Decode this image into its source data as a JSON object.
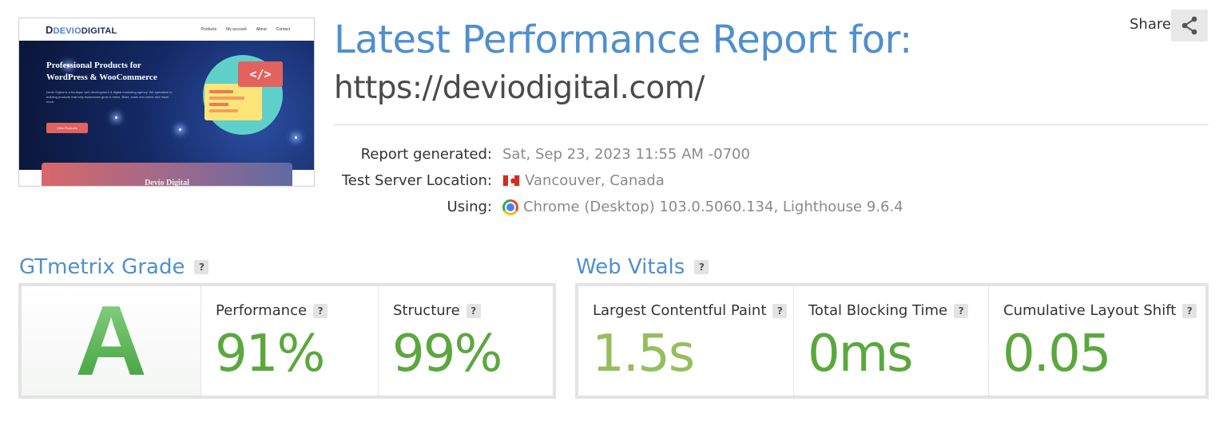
{
  "thumbnail": {
    "logo_letter": "D",
    "logo_text_a": "DEVIO",
    "logo_text_b": "DIGITAL",
    "nav": [
      "Products",
      "My account",
      "About",
      "Contact"
    ],
    "hero_title": "Professional Products for WordPress & WooCommerce",
    "hero_body": "Devio Digital is a boutique web development & digital marketing agency. We specialize in building products that help businesses grow & thrive. Build, scale and online and reach more.",
    "hero_button": "View Products",
    "code_symbol": "</>",
    "card_text": "Devio Digital"
  },
  "header": {
    "title": "Latest Performance Report for:",
    "url": "https://deviodigital.com/"
  },
  "share": {
    "label": "Share",
    "icon": "share-icon"
  },
  "meta": {
    "generated_label": "Report generated:",
    "generated_value": "Sat, Sep 23, 2023 11:55 AM -0700",
    "location_label": "Test Server Location:",
    "location_value": "Vancouver, Canada",
    "location_icon": "canada-flag-icon",
    "using_label": "Using:",
    "using_value": "Chrome (Desktop) 103.0.5060.134, Lighthouse 9.6.4",
    "using_icon": "chrome-icon"
  },
  "grade_section": {
    "title": "GTmetrix Grade",
    "help": "?",
    "grade": "A",
    "performance_label": "Performance",
    "performance_value": "91%",
    "structure_label": "Structure",
    "structure_value": "99%"
  },
  "vitals_section": {
    "title": "Web Vitals",
    "help": "?",
    "lcp_label": "Largest Contentful Paint",
    "lcp_value": "1.5s",
    "tbt_label": "Total Blocking Time",
    "tbt_value": "0ms",
    "cls_label": "Cumulative Layout Shift",
    "cls_value": "0.05"
  },
  "colors": {
    "accent_blue": "#4f8fd0",
    "grade_green": "#4faf46",
    "good_green": "#5aa83e",
    "lcp_green": "#94bf5c"
  }
}
